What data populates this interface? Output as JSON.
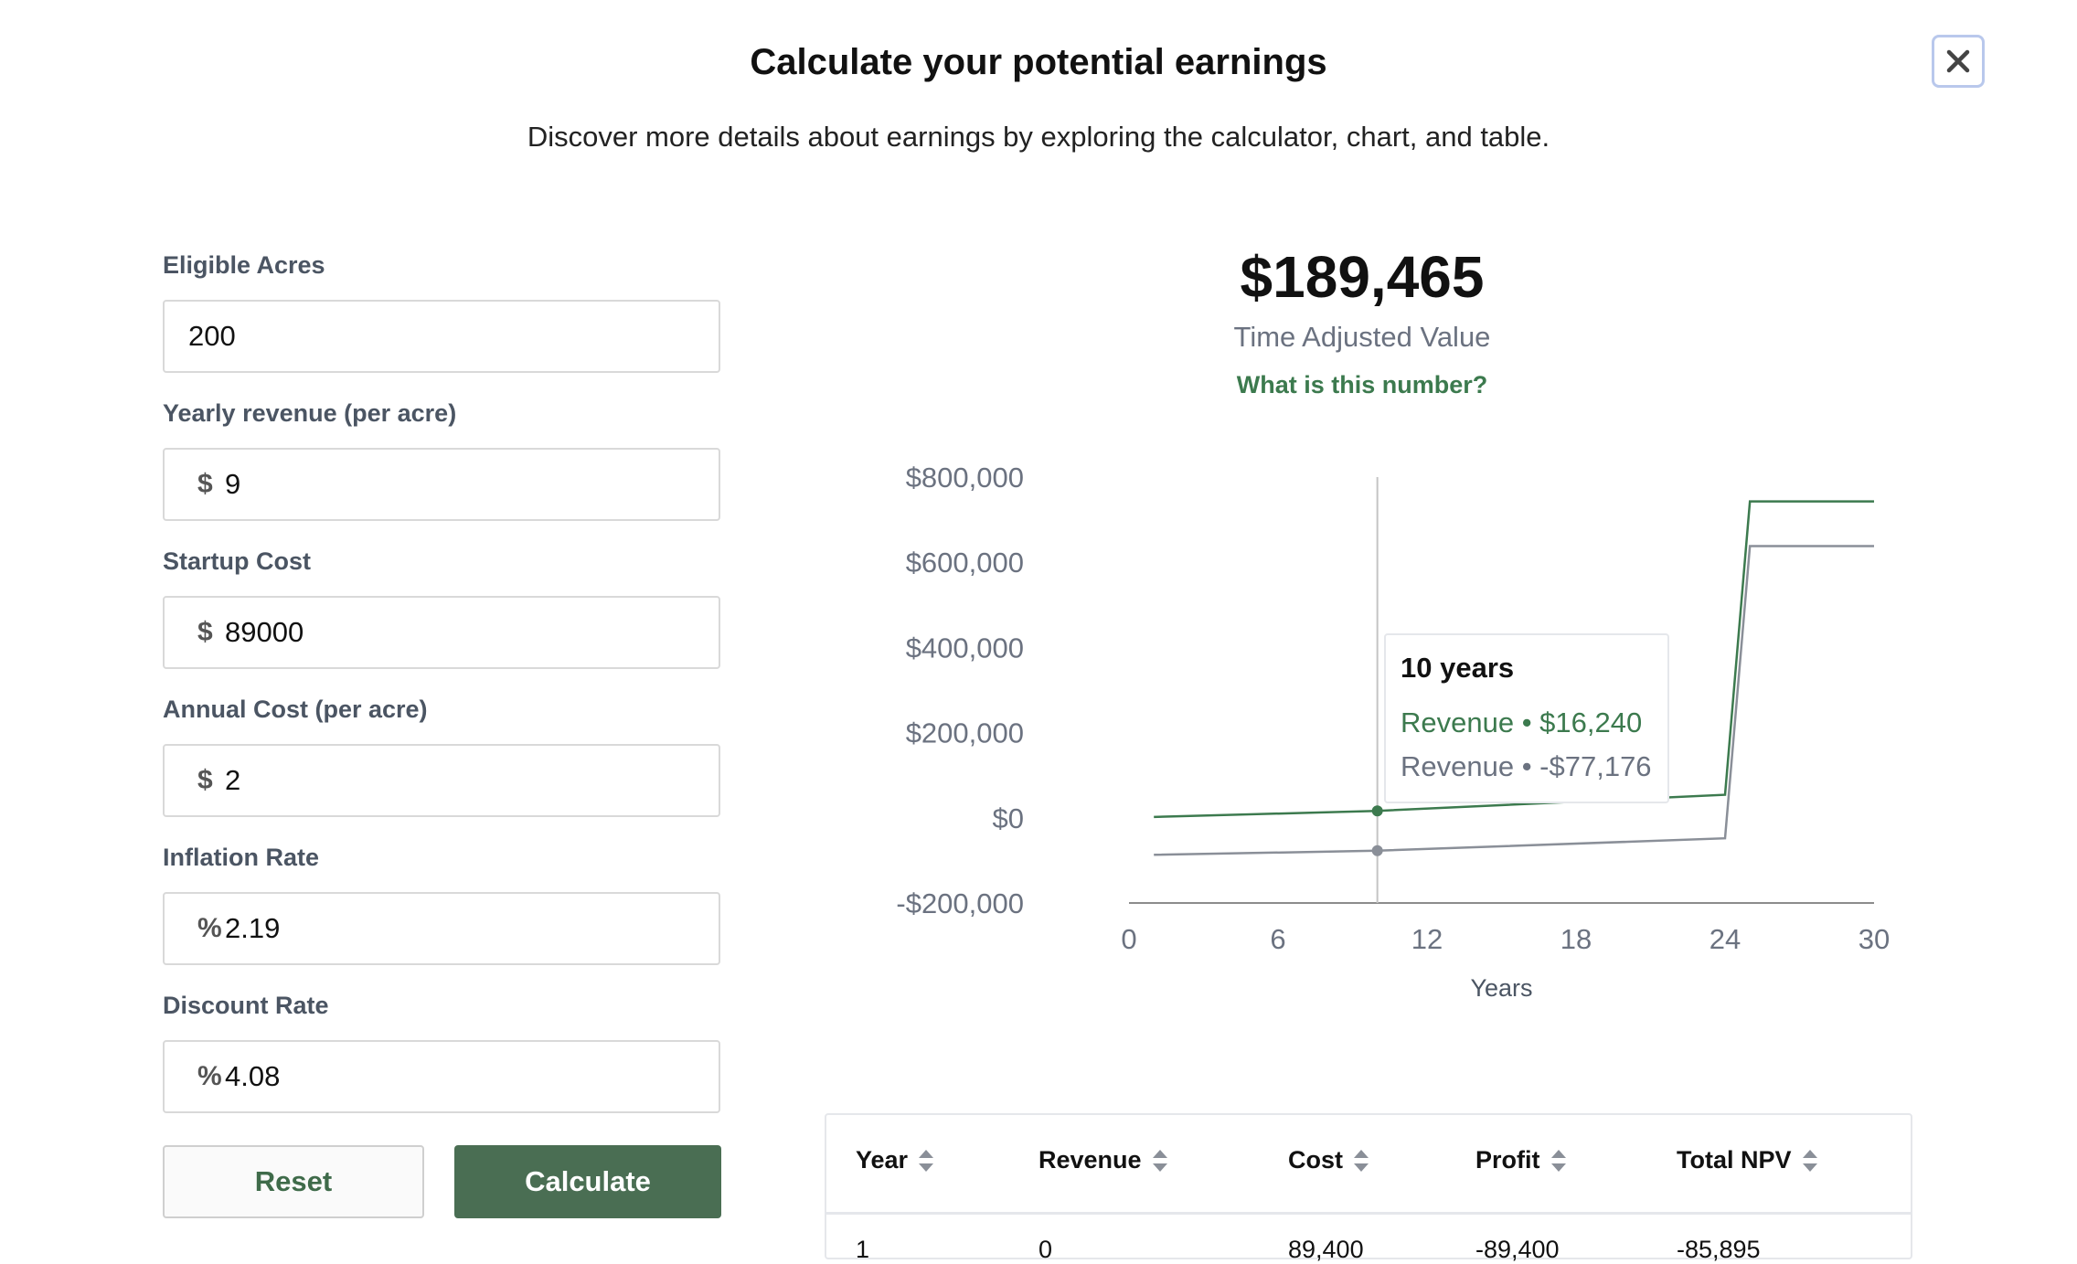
{
  "header": {
    "title": "Calculate your potential earnings",
    "subtitle": "Discover more details about earnings by exploring the calculator, chart, and table.",
    "close_icon": "close-icon"
  },
  "form": {
    "eligible_acres": {
      "label": "Eligible Acres",
      "value": "200"
    },
    "yearly_revenue": {
      "label": "Yearly revenue (per acre)",
      "prefix": "$",
      "value": "9"
    },
    "startup_cost": {
      "label": "Startup Cost",
      "prefix": "$",
      "value": "89000"
    },
    "annual_cost": {
      "label": "Annual Cost (per acre)",
      "prefix": "$",
      "value": "2"
    },
    "inflation_rate": {
      "label": "Inflation Rate",
      "prefix": "%",
      "value": "2.19"
    },
    "discount_rate": {
      "label": "Discount Rate",
      "prefix": "%",
      "value": "4.08"
    },
    "reset_label": "Reset",
    "calculate_label": "Calculate"
  },
  "summary": {
    "value": "$189,465",
    "caption": "Time Adjusted Value",
    "link": "What is this number?"
  },
  "chart_data": {
    "type": "line",
    "xlabel": "Years",
    "ylabel": "",
    "xlim": [
      0,
      30
    ],
    "ylim": [
      -200000,
      800000
    ],
    "x_ticks": [
      "0",
      "6",
      "12",
      "18",
      "24",
      "30"
    ],
    "y_ticks": [
      "$800,000",
      "$600,000",
      "$400,000",
      "$200,000",
      "$0",
      "-$200,000"
    ],
    "colors": {
      "revenue": "#3c7a4e",
      "npv": "#8a8f98"
    },
    "series": [
      {
        "key": "revenue",
        "points": [
          [
            1,
            2000
          ],
          [
            10,
            16240
          ],
          [
            24,
            54000
          ],
          [
            25,
            743000
          ],
          [
            30,
            743000
          ]
        ]
      },
      {
        "key": "npv",
        "points": [
          [
            1,
            -87000
          ],
          [
            10,
            -77176
          ],
          [
            24,
            -48000
          ],
          [
            25,
            638000
          ],
          [
            30,
            638000
          ]
        ]
      }
    ],
    "hover": {
      "x": 10
    }
  },
  "tooltip": {
    "title": "10 years",
    "rows": [
      {
        "label": "Revenue • $16,240"
      },
      {
        "label": "Revenue • -$77,176"
      }
    ]
  },
  "table": {
    "columns": [
      "Year",
      "Revenue",
      "Cost",
      "Profit",
      "Total NPV"
    ],
    "rows": [
      [
        "1",
        "0",
        "89,400",
        "-89,400",
        "-85,895"
      ]
    ]
  }
}
